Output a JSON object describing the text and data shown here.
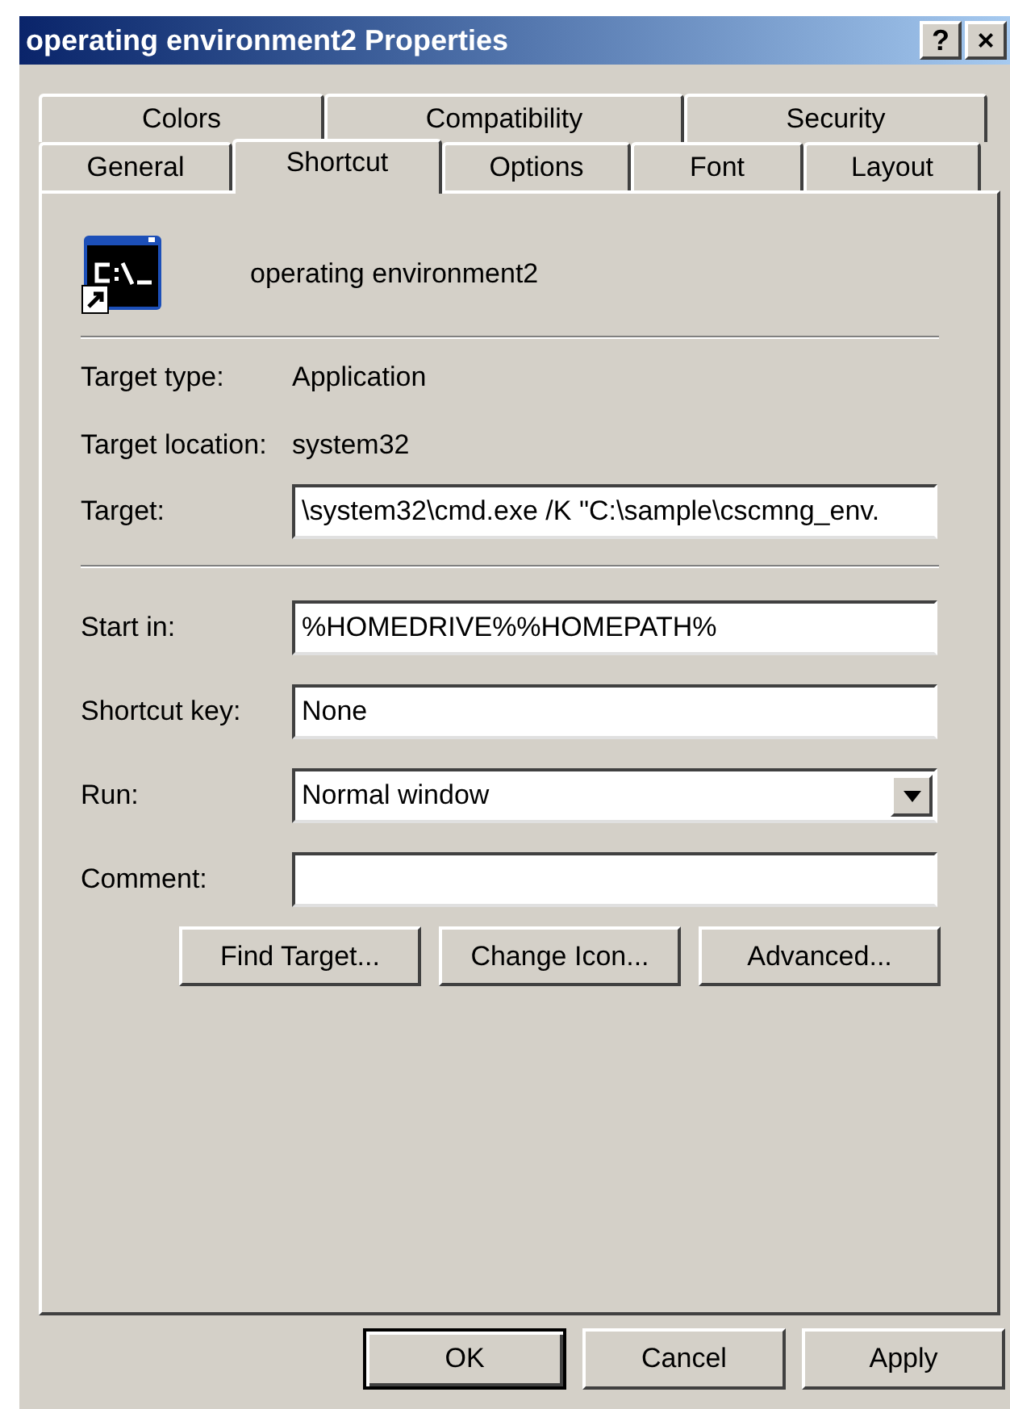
{
  "window": {
    "title": "operating environment2 Properties",
    "title_buttons": [
      "?",
      "×"
    ]
  },
  "tab_rows": [
    [
      {
        "label": "Colors",
        "selected": false
      },
      {
        "label": "Compatibility",
        "selected": false
      },
      {
        "label": "Security",
        "selected": false
      }
    ],
    [
      {
        "label": "General",
        "selected": false
      },
      {
        "label": "Shortcut",
        "selected": true
      },
      {
        "label": "Options",
        "selected": false
      },
      {
        "label": "Font",
        "selected": false
      },
      {
        "label": "Layout",
        "selected": false
      }
    ]
  ],
  "shortcut_name": "operating environment2",
  "info": [
    {
      "label": "Target type:",
      "value": "Application"
    },
    {
      "label": "Target location:",
      "value": "system32"
    }
  ],
  "target": {
    "label": "Target:",
    "value": "\\system32\\cmd.exe /K \"C:\\sample\\cscmng_env."
  },
  "fields": [
    {
      "kind": "text",
      "label": "Start in:",
      "value": "%HOMEDRIVE%%HOMEPATH%"
    },
    {
      "kind": "text",
      "label": "Shortcut key:",
      "value": "None"
    },
    {
      "kind": "dropdown",
      "label": "Run:",
      "value": "Normal window"
    },
    {
      "kind": "text",
      "label": "Comment:"
    }
  ],
  "actions": [
    "Find Target...",
    "Change Icon...",
    "Advanced..."
  ],
  "dialog_buttons": [
    {
      "label": "OK",
      "default": true
    },
    {
      "label": "Cancel",
      "default": false
    },
    {
      "label": "Apply",
      "default": false
    }
  ]
}
